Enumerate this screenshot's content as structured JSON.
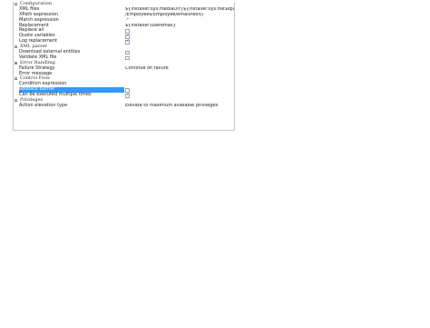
{
  "properties": [
    {
      "type": "category",
      "label": "Configuration"
    },
    {
      "type": "text",
      "label": "XML files",
      "value": "${installer:sys.mediaDir}${installer:sys.fileSeparator}d..."
    },
    {
      "type": "text",
      "label": "XPath expression",
      "value": "/Employees/Employee/email/text()"
    },
    {
      "type": "text",
      "label": "Match expression",
      "value": ".*"
    },
    {
      "type": "text",
      "label": "Replacement",
      "value": "${installer:useremail}"
    },
    {
      "type": "check",
      "label": "Replace all",
      "checked": false
    },
    {
      "type": "check",
      "label": "Quote variables",
      "checked": true
    },
    {
      "type": "check",
      "label": "Log replacement",
      "checked": true
    },
    {
      "type": "category",
      "label": "XML parser"
    },
    {
      "type": "check",
      "label": "Download external entities",
      "checked": false
    },
    {
      "type": "check",
      "label": "Validate XML file",
      "checked": false
    },
    {
      "type": "category",
      "label": "Error Handling"
    },
    {
      "type": "text",
      "label": "Failure Strategy",
      "value": "Continue on failure"
    },
    {
      "type": "text",
      "label": "Error message",
      "value": ""
    },
    {
      "type": "category",
      "label": "Control Flow"
    },
    {
      "type": "text",
      "label": "Condition expression",
      "value": ""
    },
    {
      "type": "check",
      "label": "Rollback barrier",
      "checked": false,
      "selected": true
    },
    {
      "type": "check",
      "label": "Can be executed multiple times",
      "checked": true
    },
    {
      "type": "category",
      "label": "Privileges"
    },
    {
      "type": "text",
      "label": "Action elevation type",
      "value": "Elevate to maximum available privileges"
    }
  ]
}
